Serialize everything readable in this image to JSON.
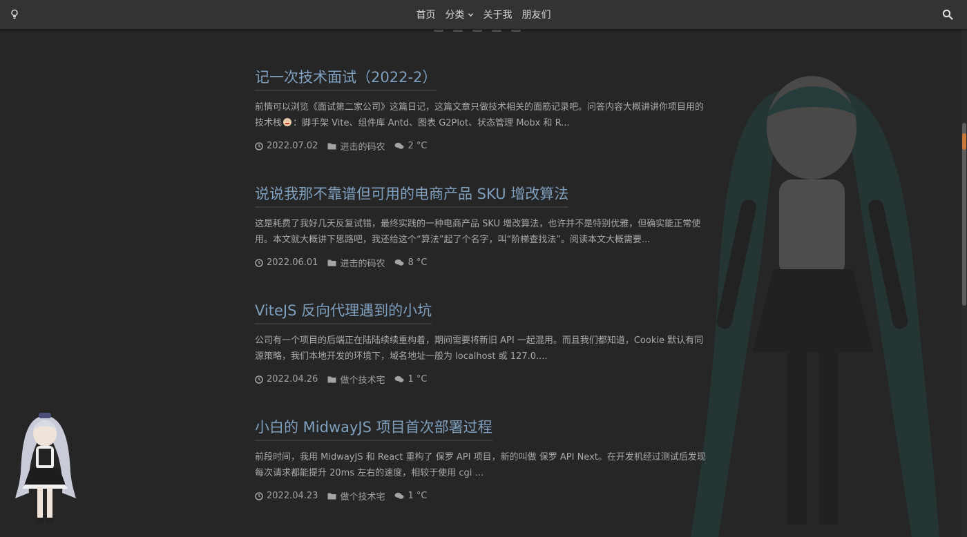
{
  "nav": {
    "left_icon": "lightbulb-icon",
    "items": [
      {
        "label": "首页"
      },
      {
        "label": "分类",
        "has_dropdown": true
      },
      {
        "label": "关于我"
      },
      {
        "label": "朋友们"
      }
    ],
    "search_icon": "search-icon"
  },
  "posts": [
    {
      "title": "记一次技术面试（2022-2）",
      "excerpt_a": "前情可以浏览《面试第二家公司》这篇日记，这篇文章只做技术相关的面筋记录吧。问答内容大概讲讲你项目用的技术栈",
      "excerpt_b": "：脚手架 Vite、组件库 Antd、图表 G2Plot、状态管理 Mobx 和 R...",
      "date": "2022.07.02",
      "category": "进击的码农",
      "comments": "2 °C"
    },
    {
      "title": "说说我那不靠谱但可用的电商产品 SKU 增改算法",
      "excerpt_a": "这是耗费了我好几天反复试错，最终实践的一种电商产品 SKU 增改算法，也许并不是特别优雅，但确实能正常使用。本文就大概讲下思路吧，我还给这个“算法”起了个名字，叫“阶梯查找法”。阅读本文大概需要...",
      "excerpt_b": "",
      "date": "2022.06.01",
      "category": "进击的码农",
      "comments": "8 °C"
    },
    {
      "title": "ViteJS 反向代理遇到的小坑",
      "excerpt_a": "公司有一个项目的后端正在陆陆续续重构着，期间需要将新旧 API 一起混用。而且我们都知道，Cookie 默认有同源策略，我们本地开发的环境下，域名地址一般为 localhost 或 127.0....",
      "excerpt_b": "",
      "date": "2022.04.26",
      "category": "做个技术宅",
      "comments": "1 °C"
    },
    {
      "title": "小白的 MidwayJS 项目首次部署过程",
      "excerpt_a": "前段时间，我用 MidwayJS 和 React 重构了 保罗 API 项目，新的叫做 保罗 API Next。在开发机经过测试后发现每次请求都能提升 20ms 左右的速度，相较于使用 cgi ...",
      "excerpt_b": "",
      "date": "2022.04.23",
      "category": "做个技术宅",
      "comments": "1 °C"
    }
  ],
  "icons": {
    "date": "clock-icon",
    "category": "folder-icon",
    "comments": "comments-icon"
  },
  "colors": {
    "background": "#262626",
    "navbar": "#333333",
    "title_link": "#7f9fbe",
    "text": "#a9a9a9"
  }
}
